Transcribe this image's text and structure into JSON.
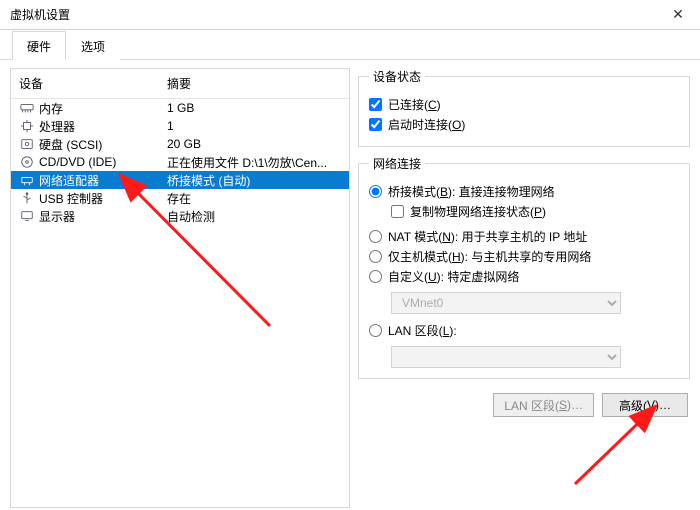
{
  "titlebar": {
    "title": "虚拟机设置"
  },
  "tabs": {
    "hardware": "硬件",
    "options": "选项"
  },
  "device_header": {
    "device": "设备",
    "summary": "摘要"
  },
  "devices": [
    {
      "icon": "memory-icon",
      "name": "内存",
      "summary": "1 GB"
    },
    {
      "icon": "cpu-icon",
      "name": "处理器",
      "summary": "1"
    },
    {
      "icon": "disk-icon",
      "name": "硬盘 (SCSI)",
      "summary": "20 GB"
    },
    {
      "icon": "cd-icon",
      "name": "CD/DVD (IDE)",
      "summary": "正在使用文件 D:\\1\\勿放\\Cen..."
    },
    {
      "icon": "network-icon",
      "name": "网络适配器",
      "summary": "桥接模式 (自动)"
    },
    {
      "icon": "usb-icon",
      "name": "USB 控制器",
      "summary": "存在"
    },
    {
      "icon": "display-icon",
      "name": "显示器",
      "summary": "自动检测"
    }
  ],
  "status_group": {
    "legend": "设备状态",
    "connected": "已连接(",
    "connected_hotkey": "C",
    "connected_end": ")",
    "connect_at_power": "启动时连接(",
    "connect_at_power_hotkey": "O",
    "connect_at_power_end": ")"
  },
  "net_group": {
    "legend": "网络连接",
    "bridged": "桥接模式(",
    "bridged_hotkey": "B",
    "bridged_mid": "): 直接连接物理网络",
    "replicate": "复制物理网络连接状态(",
    "replicate_hotkey": "P",
    "replicate_end": ")",
    "nat": "NAT 模式(",
    "nat_hotkey": "N",
    "nat_mid": "): 用于共享主机的 IP 地址",
    "hostonly": "仅主机模式(",
    "hostonly_hotkey": "H",
    "hostonly_mid": "): 与主机共享的专用网络",
    "custom": "自定义(",
    "custom_hotkey": "U",
    "custom_mid": "): 特定虚拟网络",
    "vmnet_value": "VMnet0",
    "lan": "LAN 区段(",
    "lan_hotkey": "L",
    "lan_end": "):",
    "lan_value": ""
  },
  "buttons": {
    "lan_segments": "LAN 区段(",
    "lan_segments_hotkey": "S",
    "lan_segments_end": ")…",
    "advanced": "高级(",
    "advanced_hotkey": "V",
    "advanced_end": ")…"
  },
  "selected_index": 4
}
